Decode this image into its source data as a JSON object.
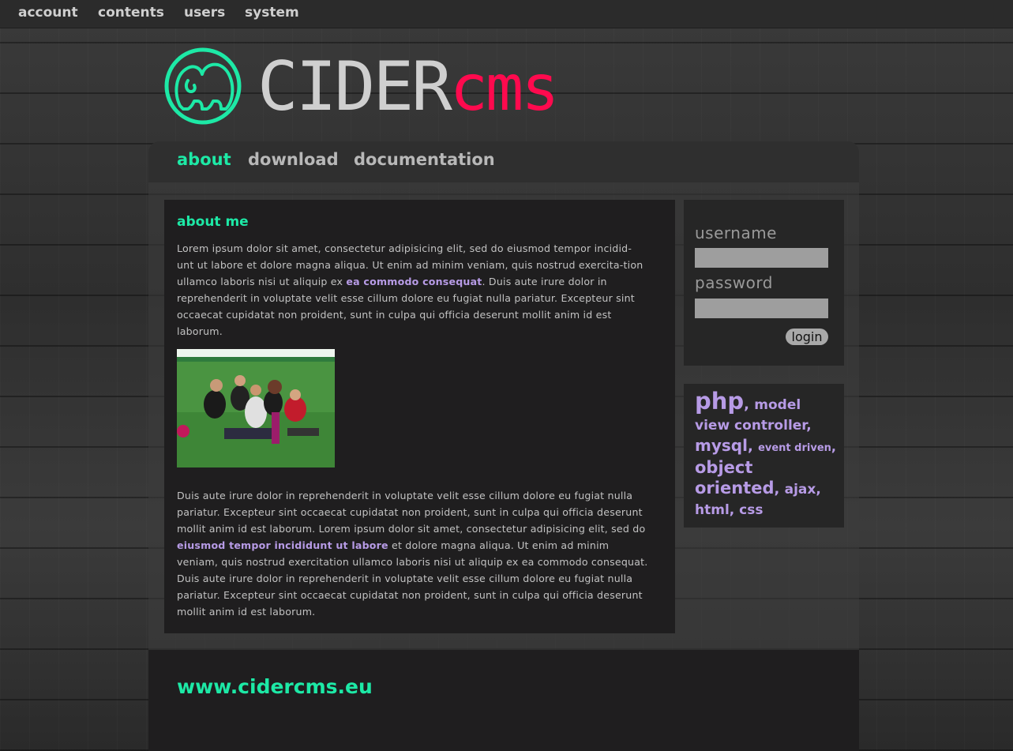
{
  "topbar": {
    "items": [
      {
        "label": "account"
      },
      {
        "label": "contents"
      },
      {
        "label": "users"
      },
      {
        "label": "system"
      }
    ]
  },
  "logo": {
    "text_main": "CIDER",
    "text_accent": "cms",
    "icon": "elephant-icon",
    "colors": {
      "ring": "#1de9a6",
      "main": "#cfcfcf",
      "accent": "#ff0a4e"
    }
  },
  "nav": {
    "tabs": [
      {
        "label": "about",
        "active": true
      },
      {
        "label": "download",
        "active": false
      },
      {
        "label": "documentation",
        "active": false
      }
    ]
  },
  "main": {
    "title": "about me",
    "para1_pre": "Lorem ipsum dolor sit amet, consectetur adipisicing elit, sed do eiusmod tempor incidid-unt ut labore et dolore magna aliqua. Ut enim ad minim veniam, quis nostrud exercita-tion ullamco laboris nisi ut aliquip ex ",
    "para1_link": "ea commodo consequat",
    "para1_post": ". Duis aute irure dolor in reprehenderit in voluptate velit esse cillum dolore eu fugiat nulla pariatur. Excepteur sint occaecat cupidatat non proident, sunt in culpa qui officia deserunt mollit anim id est laborum.",
    "para2_pre": "Duis aute irure dolor in reprehenderit in voluptate velit esse cillum dolore eu fugiat nulla pariatur. Excepteur sint occaecat cupidatat non proident, sunt in culpa qui officia deserunt mollit anim id est laborum. Lorem ipsum dolor sit amet, consectetur adipisicing elit, sed do ",
    "para2_link": "eiusmod tempor incididunt ut labore",
    "para2_post": " et dolore magna aliqua. Ut enim ad minim veniam, quis nostrud exercitation ullamco laboris nisi ut aliquip ex ea commodo consequat. Duis aute irure dolor in reprehenderit in voluptate velit esse cillum dolore eu fugiat nulla pariatur. Excepteur sint occaecat cupidatat non proident, sunt in culpa qui officia deserunt mollit anim id est laborum."
  },
  "login": {
    "username_label": "username",
    "password_label": "password",
    "button_label": "login",
    "username_value": "",
    "password_value": ""
  },
  "tags": [
    {
      "label": "php"
    },
    {
      "label": "model view controller"
    },
    {
      "label": "mysql"
    },
    {
      "label": "event driven"
    },
    {
      "label": "object oriented"
    },
    {
      "label": "ajax"
    },
    {
      "label": "html"
    },
    {
      "label": "css"
    }
  ],
  "footer": {
    "url": "www.cidercms.eu"
  }
}
